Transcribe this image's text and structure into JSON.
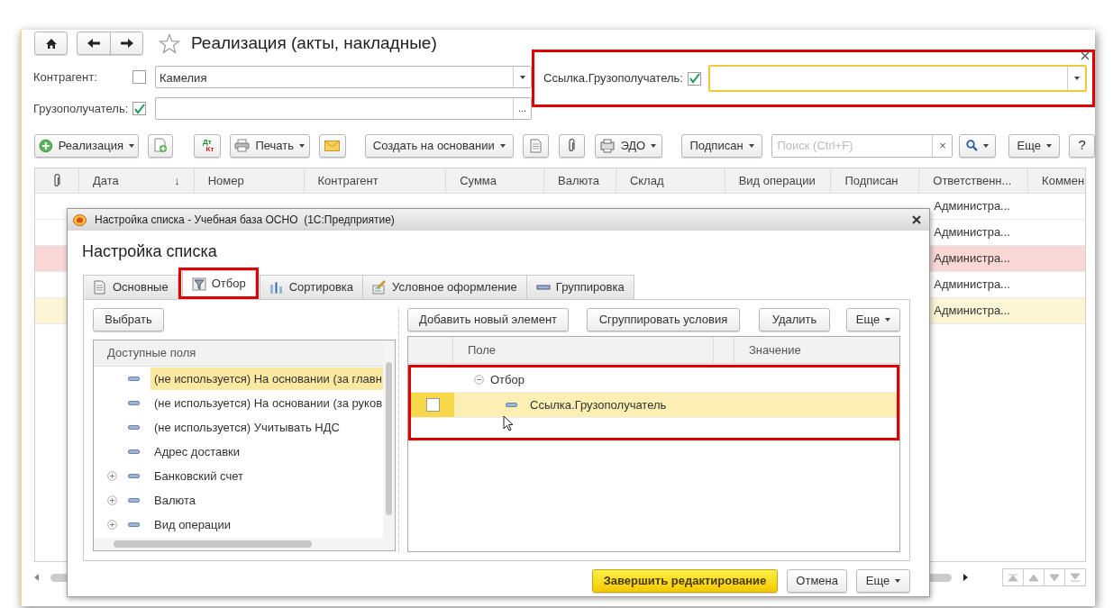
{
  "window": {
    "title": "Реализация (акты, накладные)",
    "favorite": false
  },
  "filters": [
    {
      "label": "Контрагент:",
      "checked": false,
      "value": "Камелия",
      "kind": "dropdown"
    },
    {
      "label": "Грузополучатель:",
      "checked": true,
      "kind": "picker",
      "button_text": "..."
    }
  ],
  "extra_filter": {
    "label": "Ссылка.Грузополучатель:",
    "checked": true,
    "focused": true,
    "annotated": true
  },
  "toolbar": [
    {
      "kind": "text",
      "label": "Реализация",
      "menu": true
    },
    {
      "kind": "icon",
      "menu": false
    },
    {
      "kind": "icon",
      "icon_text": [
        "Дт",
        "Кт"
      ],
      "menu": false
    },
    {
      "kind": "text",
      "label": "Печать",
      "menu": true
    },
    {
      "kind": "icon",
      "menu": false
    },
    {
      "kind": "text",
      "label": "Создать на основании",
      "menu": true
    },
    {
      "kind": "icon",
      "menu": false
    },
    {
      "kind": "icon",
      "menu": false
    },
    {
      "kind": "text",
      "label": "ЭДО",
      "menu": true
    },
    {
      "kind": "text",
      "label": "Подписан",
      "menu": true
    }
  ],
  "search": {
    "placeholder": "Поиск (Ctrl+F)",
    "clear": "×"
  },
  "toolbar_end": [
    {
      "kind": "search",
      "menu": true
    },
    {
      "kind": "text",
      "label": "Еще",
      "menu": true
    },
    {
      "kind": "text",
      "label": "?",
      "menu": false
    }
  ],
  "table": {
    "columns": [
      {
        "kind": "icon"
      },
      {
        "label": "Дата",
        "sort_mark": "↓"
      },
      {
        "label": "Номер"
      },
      {
        "label": "Контрагент"
      },
      {
        "label": "Сумма"
      },
      {
        "label": "Валюта"
      },
      {
        "label": "Склад"
      },
      {
        "label": "Вид операции"
      },
      {
        "label": "Подписан"
      },
      {
        "label": "Ответственн..."
      },
      {
        "label": "Коммен"
      }
    ],
    "rows": [
      {
        "responsible": "Администра..."
      },
      {
        "responsible": "Администра..."
      },
      {
        "responsible": "Администра...",
        "color": "#f9d7d7"
      },
      {
        "responsible": "Администра..."
      },
      {
        "responsible": "Администра...",
        "color": "#fcf6d6"
      }
    ]
  },
  "dialog": {
    "title": "Настройка списка - Учебная база ОСНО  (1С:Предприятие)",
    "heading": "Настройка списка",
    "tabs": [
      {
        "label": "Основные",
        "selected": false,
        "annotated": false
      },
      {
        "label": "Отбор",
        "selected": true,
        "annotated": true
      },
      {
        "label": "Сортировка",
        "selected": false,
        "annotated": false
      },
      {
        "label": "Условное оформление",
        "selected": false,
        "annotated": false
      },
      {
        "label": "Группировка",
        "selected": false,
        "annotated": false
      }
    ],
    "choose_button": "Выбрать",
    "fields_header": "Доступные поля",
    "fields": [
      {
        "label": "(не используется) На основании (за главн",
        "kind": "field",
        "selected": true
      },
      {
        "label": "(не используется) На основании (за руков",
        "kind": "field",
        "selected": false
      },
      {
        "label": "(не используется) Учитывать НДС",
        "kind": "field",
        "selected": false
      },
      {
        "label": "Адрес доставки",
        "kind": "field",
        "selected": false
      },
      {
        "label": "Банковский счет",
        "kind": "group",
        "selected": false
      },
      {
        "label": "Валюта",
        "kind": "group",
        "selected": false
      },
      {
        "label": "Вид операции",
        "kind": "group",
        "selected": false
      }
    ],
    "actions": [
      {
        "label": "Добавить новый элемент",
        "menu": false
      },
      {
        "label": "Сгруппировать условия",
        "menu": false
      },
      {
        "label": "Удалить",
        "menu": false
      },
      {
        "label": "Еще",
        "menu": true
      }
    ],
    "filter_columns": [
      "Поле",
      "Значение"
    ],
    "filter_annotated": true,
    "filter_items": [
      {
        "label": "Отбор",
        "expanded": true,
        "children": [
          {
            "label": "Ссылка.Грузополучатель",
            "checked": false,
            "selected": true
          }
        ]
      }
    ],
    "footer": [
      {
        "label": "Завершить редактирование",
        "kind": "primary",
        "menu": false
      },
      {
        "label": "Отмена",
        "kind": "normal",
        "menu": false
      },
      {
        "label": "Еще",
        "kind": "normal",
        "menu": true
      }
    ]
  }
}
